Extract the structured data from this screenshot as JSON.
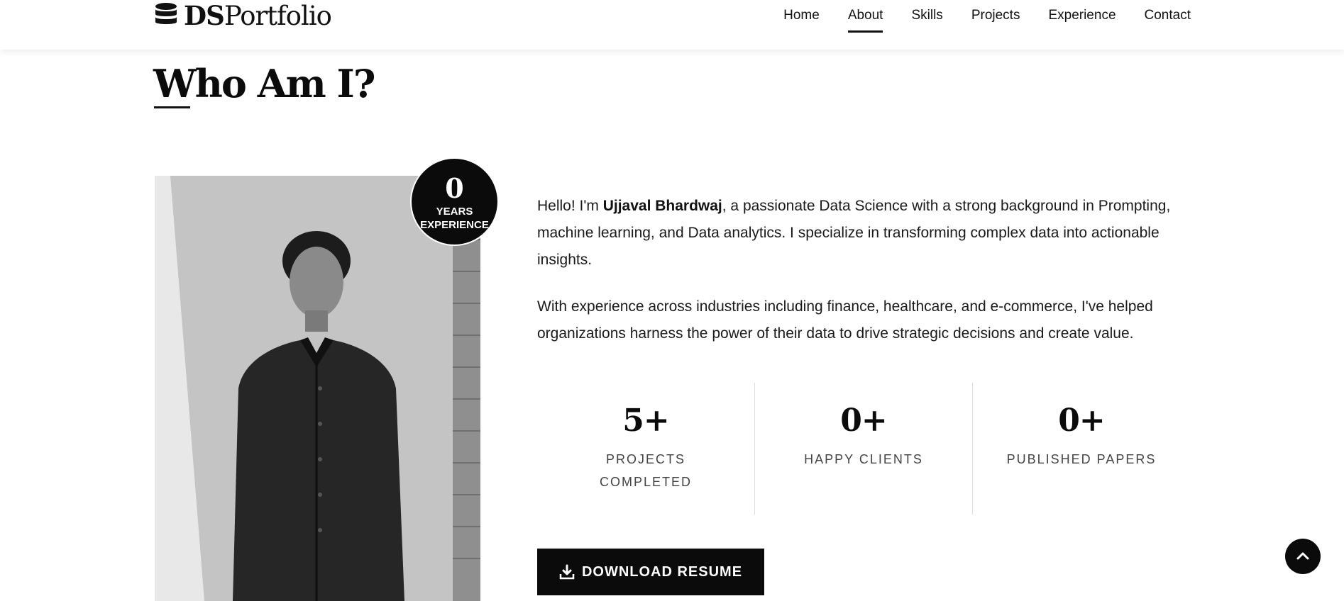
{
  "brand": {
    "bold": "DS",
    "regular": "Portfolio",
    "icon": "database-icon"
  },
  "nav": {
    "items": [
      {
        "label": "Home",
        "active": false
      },
      {
        "label": "About",
        "active": true
      },
      {
        "label": "Skills",
        "active": false
      },
      {
        "label": "Projects",
        "active": false
      },
      {
        "label": "Experience",
        "active": false
      },
      {
        "label": "Contact",
        "active": false
      }
    ]
  },
  "about": {
    "title": "Who Am I?",
    "badge": {
      "number": "0",
      "line1": "YEARS",
      "line2": "EXPERIENCE"
    },
    "bio": {
      "greeting": "Hello! I'm ",
      "name": "Ujjaval Bhardwaj",
      "p1_rest": ", a passionate Data Science with a strong background in Prompting, machine learning, and Data analytics. I specialize in transforming complex data into actionable insights.",
      "p2": "With experience across industries including finance, healthcare, and e-commerce, I've helped organizations harness the power of their data to drive strategic decisions and create value."
    },
    "stats": [
      {
        "number": "5+",
        "label": "PROJECTS COMPLETED"
      },
      {
        "number": "0+",
        "label": "HAPPY CLIENTS"
      },
      {
        "number": "0+",
        "label": "PUBLISHED PAPERS"
      }
    ],
    "resume_button": {
      "label": "DOWNLOAD RESUME",
      "icon": "download-icon"
    }
  },
  "scroll_top": {
    "icon": "chevron-up-icon"
  },
  "colors": {
    "primary": "#0b0b0b",
    "background": "#ffffff",
    "text": "#1a1a1a",
    "muted": "#444444"
  }
}
